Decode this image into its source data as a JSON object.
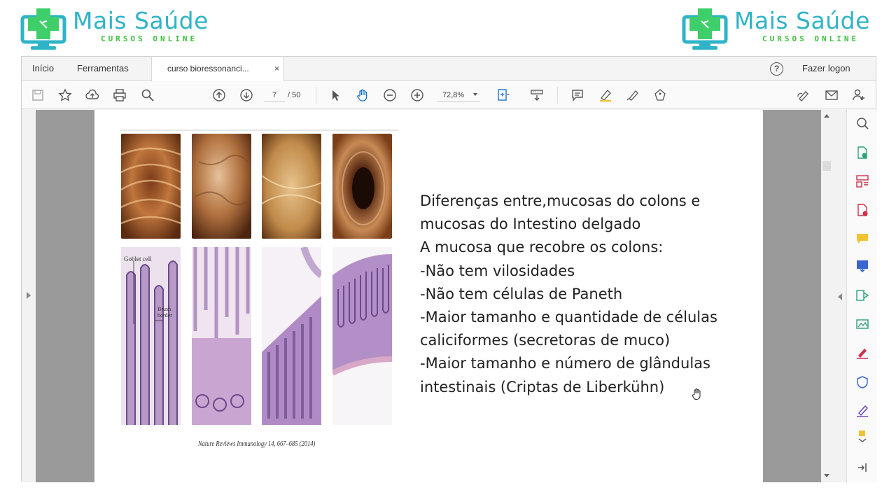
{
  "branding": {
    "title": "Mais Saúde",
    "subtitle": "CURSOS ONLINE",
    "colors": {
      "title": "#2fb3c8",
      "subtitle": "#3cc23c"
    }
  },
  "tabs": {
    "home": "Início",
    "tools": "Ferramentas",
    "document": "curso bioressonanci...",
    "close": "×"
  },
  "header": {
    "help": "?",
    "login": "Fazer logon"
  },
  "toolbar": {
    "page_current": "7",
    "page_total": "/ 50",
    "zoom": "72,8%"
  },
  "slide": {
    "lines": [
      "Diferenças entre,mucosas do colons e",
      "mucosas do Intestino delgado",
      "A mucosa que recobre os colons:",
      "-Não tem vilosidades",
      "-Não tem células de Paneth",
      "-Maior tamanho e quantidade de células",
      "caliciformes (secretoras de muco)",
      "-Maior tamanho e número de glândulas",
      "intestinais (Criptas de Liberkühn)"
    ],
    "figure_labels": {
      "goblet": "Goblet cell",
      "brush_1": "Brush",
      "brush_2": "border"
    },
    "caption": "Nature Reviews Immunology 14, 667–685 (2014)"
  }
}
